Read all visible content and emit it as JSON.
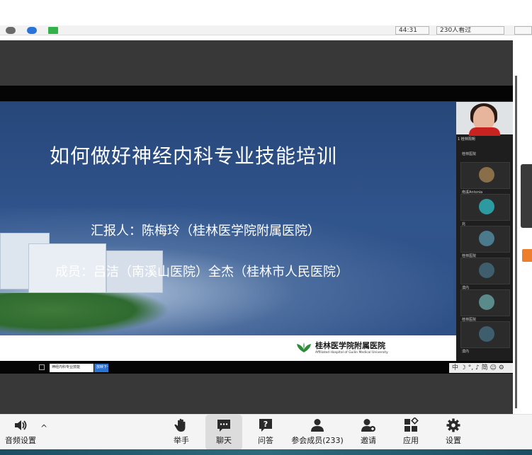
{
  "top_bar": {
    "pill_time": "44:31",
    "pill_viewers": "230人看过"
  },
  "slide": {
    "title": "如何做好神经内科专业技能培训",
    "reporter": "汇报人：陈梅玲（桂林医学院附属医院）",
    "members": "成员：吕洁（南溪山医院）全杰（桂林市人民医院）",
    "logo_cn": "桂林医学院附属医院",
    "logo_en": "Affiliated Hospital of Guilin Medical University"
  },
  "taskbar": {
    "btn1": "神经内科专业技能",
    "btn2": "放映下一",
    "ime": "中 ☽ °, ♪ 简 ☺ ⚙"
  },
  "participants": {
    "speaker_label": "1 桂林阳朔",
    "tiles": [
      {
        "name": "桂林医院",
        "avatar_color": "#a07a50"
      },
      {
        "name": "南溪Antonia",
        "avatar_color": "#8a6e4a"
      },
      {
        "name": "兆",
        "avatar_color": "#2c9aa0"
      },
      {
        "name": "桂林医院",
        "avatar_color": "#4a7a8c"
      },
      {
        "name": "漠内",
        "avatar_color": "#3e5e6e"
      },
      {
        "name": "桂林医院",
        "avatar_color": "#5a8a8a"
      },
      {
        "name": "漠内",
        "avatar_color": "#3e5e6e"
      }
    ],
    "top_name": "1 桂林阳朔"
  },
  "toolbar": {
    "audio": "音频设置",
    "raise_hand": "举手",
    "chat": "聊天",
    "qa": "问答",
    "participants": "参会成员(233)",
    "invite": "邀请",
    "apps": "应用",
    "settings": "设置"
  }
}
